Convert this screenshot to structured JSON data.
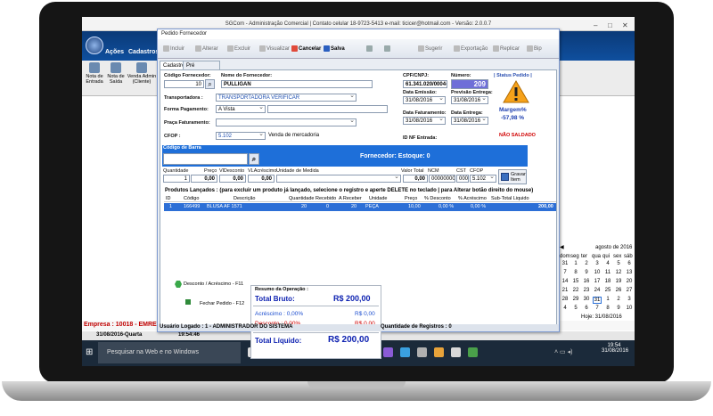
{
  "app": {
    "window_title": "SGCom - Administração Comercial | Contato celular 18-9723-5413 e-mail: ticicer@hotmail.com - Versão: 2.0.0.7",
    "menu": [
      "Ações",
      "Cadastros"
    ],
    "ribbon": [
      "Nota de Entrada",
      "Nota de Saída",
      "Venda Admin (Cliente)"
    ],
    "status_left": "Empresa : 10018 - EMRE",
    "date_line": "31/08/2016-Quarta",
    "time_line": "19:54:46"
  },
  "dialog": {
    "title": "Pedido Fornecedor",
    "toolbar": [
      "Incluir",
      "Alterar",
      "Excluir",
      "Visualizar",
      "Cancelar",
      "Salva",
      "Sugerir",
      "Exportação",
      "Replicar",
      "Bip"
    ],
    "tabs": [
      "Cadastro",
      "Pré Faturamento"
    ],
    "fields": {
      "codigo_fornecedor_label": "Código Fornecedor:",
      "codigo_fornecedor": "10",
      "nome_fornecedor_label": "Nome do Fornecedor:",
      "nome_fornecedor": "PULLIGAN",
      "cpf_cnpj_label": "CPF/CNPJ:",
      "cpf_cnpj": "61.341.020/0004-63",
      "numero_label": "Número:",
      "numero": "209",
      "status_label": "| Status Pedido |",
      "transportadora_label": "Transportadora :",
      "transportadora": "TRANSPORTADORA VERIFICAR",
      "forma_pagamento_label": "Forma Pagamento:",
      "forma_pagamento": "A Vista",
      "praca_label": "Praça Faturamento:",
      "cfop_label": "CFOP :",
      "cfop": "5.102",
      "cfop_desc": "Venda de mercadoria",
      "data_emissao_label": "Data Emissão:",
      "data_emissao": "31/08/2016",
      "previsao_label": "Previsão Entrega:",
      "previsao": "31/08/2016",
      "data_faturamento_label": "Data Faturamento:",
      "data_faturamento": "31/08/2016",
      "data_entrega_label": "Data Entrega:",
      "data_entrega": "31/08/2016",
      "margem_label": "Margem%",
      "margem": "-57,98 %",
      "nao_saldado": "NÃO SALDADO",
      "id_nf_label": "ID NF Entrada:"
    },
    "item": {
      "codigo_barra_label": "Código de Barra",
      "fornecedor_estoque": "Fornecedor:   Estoque: 0",
      "quantidade_label": "Quantidade",
      "quantidade": "1",
      "preco_label": "Preço",
      "preco": "0,00",
      "vldesconto_label": "VlDesconto",
      "vldesconto": "0,00",
      "vlacrescimo_label": "VLAcréscimo",
      "vlacrescimo": "0,00",
      "unidade_label": "Unidade de Medida",
      "valor_total_label": "Valor Total",
      "valor_total": "0,00",
      "ncm_label": "NCM",
      "ncm": "00000000",
      "cst_label": "CST",
      "cst": "000",
      "cfop_item_label": "CFOP",
      "cfop_item": "5.102",
      "gravar": "Gravar Item"
    },
    "products_header": "Produtos Lançados :   (para excluir um produto já lançado, selecione o registro e aperte DELETE no teclado | para Alterar botão direito do mouse)",
    "columns": [
      "ID",
      "Código",
      "Descrição",
      "Quantidade",
      "Recebido",
      "A Receber",
      "Unidade",
      "Preço",
      "% Desconto",
      "% Acréscimo",
      "Sub-Total Liquido"
    ],
    "rows": [
      [
        "1",
        "166499",
        "BLUSA AF 1571",
        "20",
        "0",
        "20",
        "PEÇA",
        "10,00",
        "0,00 %",
        "0,00 %",
        "200,00"
      ]
    ],
    "shortcuts": [
      "Desconto / Acréscimo - F11",
      "Fechar Pedido - F12"
    ],
    "summary": {
      "title": "Resumo da Operação :",
      "bruto_label": "Total Bruto:",
      "bruto": "R$ 200,00",
      "acrescimo_label": "Acréscimo : 0,00%",
      "acrescimo": "R$ 0,00",
      "desconto_label": "Desconto : 0,00%",
      "desconto": "R$ 0,00",
      "liquido_label": "Total Líquido:",
      "liquido": "R$ 200,00"
    },
    "footer": {
      "usuario": "Usuário Logado : 1 - ADMINISTRADOR DO SISTEMA",
      "registros": "Quantidade de Registros : 0"
    }
  },
  "calendar": {
    "title": "agosto de 2016",
    "weekdays": [
      "dom",
      "seg",
      "ter",
      "qua",
      "qui",
      "sex",
      "sáb"
    ],
    "weeks": [
      [
        "31",
        "1",
        "2",
        "3",
        "4",
        "5",
        "6"
      ],
      [
        "7",
        "8",
        "9",
        "10",
        "11",
        "12",
        "13"
      ],
      [
        "14",
        "15",
        "16",
        "17",
        "18",
        "19",
        "20"
      ],
      [
        "21",
        "22",
        "23",
        "24",
        "25",
        "26",
        "27"
      ],
      [
        "28",
        "29",
        "30",
        "31",
        "1",
        "2",
        "3"
      ],
      [
        "4",
        "5",
        "6",
        "7",
        "8",
        "9",
        "10"
      ]
    ],
    "today": "Hoje: 31/08/2016"
  },
  "taskbar": {
    "search_placeholder": "Pesquisar na Web e no Windows",
    "time": "19:54",
    "date": "31/08/2016"
  },
  "colors": {
    "accent": "#1e6fd9",
    "menu_bg": "#0b3a78",
    "total_text": "#0b1fb0",
    "alert": "#d00000"
  }
}
